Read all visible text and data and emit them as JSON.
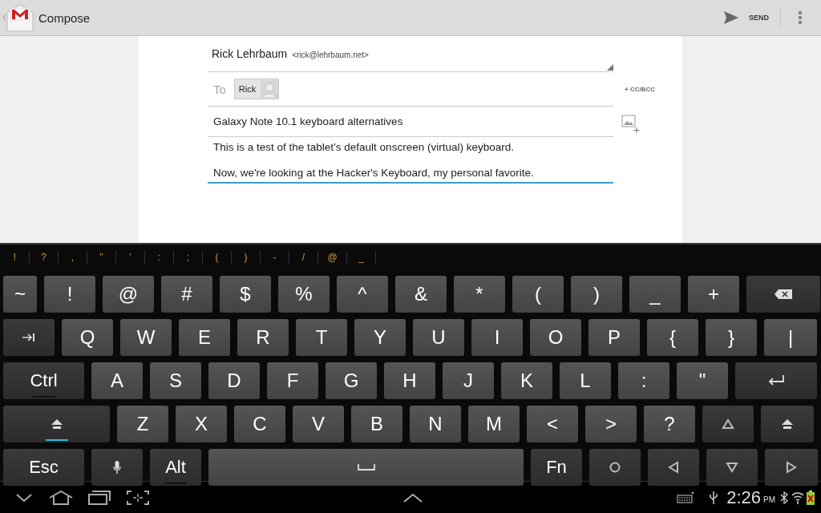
{
  "action_bar": {
    "title": "Compose",
    "send_label": "SEND"
  },
  "compose": {
    "from_name": "Rick Lehrbaum",
    "from_address": "<rick@lehrbaum.net>",
    "to_label": "To",
    "recipients": [
      {
        "name": "Rick"
      }
    ],
    "cc_bcc": "+ CC/BCC",
    "subject": "Galaxy Note 10.1 keyboard alternatives",
    "body": [
      "This is a test of the tablet’s default onscreen (virtual) keyboard.",
      "Now, we're looking at the Hacker's Keyboard, my personal favorite."
    ]
  },
  "keyboard": {
    "suggestions": [
      "!",
      "?",
      ",",
      "\"",
      "'",
      ":",
      ";",
      "(",
      ")",
      "-",
      "/",
      "@",
      "_"
    ],
    "rows": [
      [
        {
          "kind": "char",
          "label": "~"
        },
        {
          "kind": "char",
          "label": "!"
        },
        {
          "kind": "char",
          "label": "@"
        },
        {
          "kind": "char",
          "label": "#"
        },
        {
          "kind": "char",
          "label": "$"
        },
        {
          "kind": "char",
          "label": "%"
        },
        {
          "kind": "char",
          "label": "^"
        },
        {
          "kind": "char",
          "label": "&"
        },
        {
          "kind": "char",
          "label": "*"
        },
        {
          "kind": "char",
          "label": "("
        },
        {
          "kind": "char",
          "label": ")"
        },
        {
          "kind": "char",
          "label": "_"
        },
        {
          "kind": "char",
          "label": "+"
        },
        {
          "kind": "backspace"
        }
      ],
      [
        {
          "kind": "tab"
        },
        {
          "kind": "char",
          "label": "Q"
        },
        {
          "kind": "char",
          "label": "W"
        },
        {
          "kind": "char",
          "label": "E"
        },
        {
          "kind": "char",
          "label": "R"
        },
        {
          "kind": "char",
          "label": "T"
        },
        {
          "kind": "char",
          "label": "Y"
        },
        {
          "kind": "char",
          "label": "U"
        },
        {
          "kind": "char",
          "label": "I"
        },
        {
          "kind": "char",
          "label": "O"
        },
        {
          "kind": "char",
          "label": "P"
        },
        {
          "kind": "char",
          "label": "{"
        },
        {
          "kind": "char",
          "label": "}"
        },
        {
          "kind": "char",
          "label": "|"
        }
      ],
      [
        {
          "kind": "modifier",
          "label": "Ctrl",
          "on": false
        },
        {
          "kind": "char",
          "label": "A"
        },
        {
          "kind": "char",
          "label": "S"
        },
        {
          "kind": "char",
          "label": "D"
        },
        {
          "kind": "char",
          "label": "F"
        },
        {
          "kind": "char",
          "label": "G"
        },
        {
          "kind": "char",
          "label": "H"
        },
        {
          "kind": "char",
          "label": "J"
        },
        {
          "kind": "char",
          "label": "K"
        },
        {
          "kind": "char",
          "label": "L"
        },
        {
          "kind": "char",
          "label": ":"
        },
        {
          "kind": "char",
          "label": "\""
        },
        {
          "kind": "enter"
        }
      ],
      [
        {
          "kind": "shift",
          "on": true
        },
        {
          "kind": "char",
          "label": "Z"
        },
        {
          "kind": "char",
          "label": "X"
        },
        {
          "kind": "char",
          "label": "C"
        },
        {
          "kind": "char",
          "label": "V"
        },
        {
          "kind": "char",
          "label": "B"
        },
        {
          "kind": "char",
          "label": "N"
        },
        {
          "kind": "char",
          "label": "M"
        },
        {
          "kind": "char",
          "label": "<"
        },
        {
          "kind": "char",
          "label": ">"
        },
        {
          "kind": "char",
          "label": "?"
        },
        {
          "kind": "up"
        },
        {
          "kind": "shift"
        }
      ],
      [
        {
          "kind": "modifier",
          "label": "Esc"
        },
        {
          "kind": "mic"
        },
        {
          "kind": "modifier",
          "label": "Alt",
          "on": false
        },
        {
          "kind": "space"
        },
        {
          "kind": "modifier",
          "label": "Fn"
        },
        {
          "kind": "circle"
        },
        {
          "kind": "left"
        },
        {
          "kind": "down"
        },
        {
          "kind": "right"
        }
      ]
    ]
  },
  "status_bar": {
    "time": "2:26",
    "ampm": "PM"
  }
}
